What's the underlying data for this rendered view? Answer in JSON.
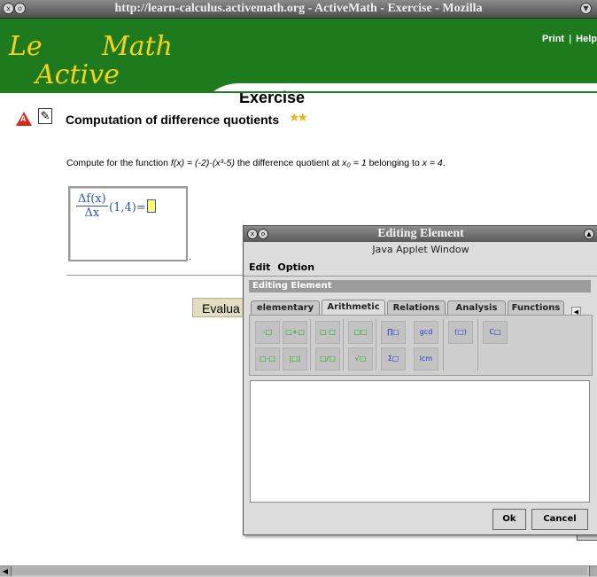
{
  "browser": {
    "title": "http://learn-calculus.activemath.org - ActiveMath - Exercise - Mozilla"
  },
  "header": {
    "logo_le": "Le",
    "logo_math": "Math",
    "logo_active": "Active",
    "links": [
      "Print",
      "Help"
    ],
    "section_title": "Exercise",
    "brand_color": "#1d7b1d",
    "logo_color": "#f6d21a"
  },
  "exercise": {
    "title": "Computation of difference quotients",
    "difficulty_stars": 2,
    "instruction_prefix": "Compute for the function ",
    "instruction_function": "f(x) = (-2)·(x³-5)",
    "instruction_middle": " the difference quotient at ",
    "instruction_x0": "x₀ = 1",
    "instruction_suffix_1": " belonging to ",
    "instruction_x": "x = 4",
    "instruction_end": ".",
    "formula_numerator": "Δf(x)",
    "formula_denominator": "Δx",
    "formula_rest": "(1,4)=",
    "evaluate_label": "Evalua"
  },
  "applet": {
    "title": "Editing Element",
    "subtitle": "Java Applet Window",
    "menu": [
      "Edit",
      "Option"
    ],
    "section": "Editing Element",
    "tabs": [
      "elementary",
      "Arithmetic",
      "Relations",
      "Analysis",
      "Functions"
    ],
    "active_tab": "Arithmetic",
    "palette": [
      "-□",
      "□+□",
      "□·□",
      "□□",
      "∏□",
      "gcd",
      "(□)",
      "C□",
      "□-□",
      "|□|",
      "□/□",
      "√□",
      "Σ□",
      "lcm"
    ],
    "ok_label": "Ok",
    "cancel_label": "Cancel"
  }
}
